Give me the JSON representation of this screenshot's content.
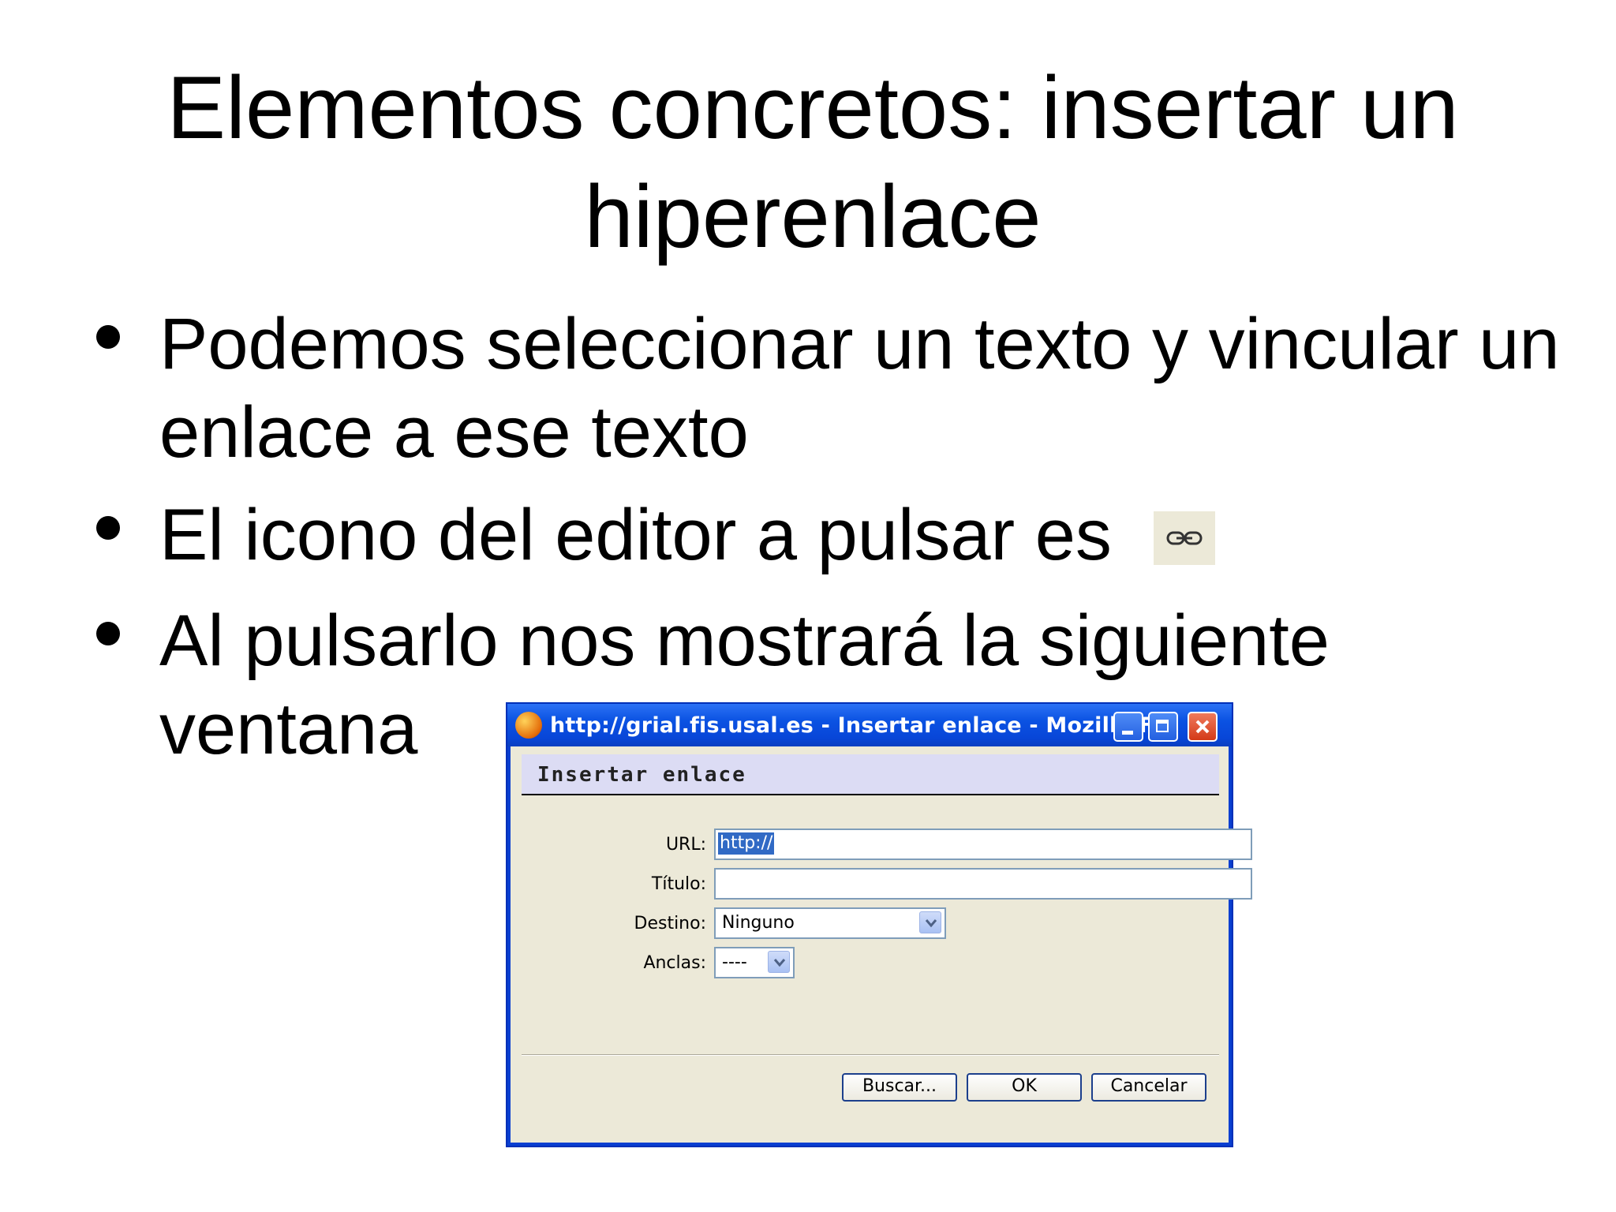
{
  "slide": {
    "title": "Elementos concretos: insertar un hiperenlace",
    "bullets": [
      {
        "text": "Podemos seleccionar un texto y vincular un enlace a ese texto"
      },
      {
        "text": "El icono del editor a pulsar es"
      },
      {
        "text": "Al pulsarlo nos mostrará la siguiente ventana"
      }
    ],
    "editor_icon": "link-icon"
  },
  "dialog": {
    "window_title": "http://grial.fis.usal.es - Insertar enlace - Mozilla F...",
    "header": "Insertar enlace",
    "fields": {
      "url": {
        "label": "URL:",
        "value": "http://"
      },
      "titulo": {
        "label": "Título:",
        "value": ""
      },
      "destino": {
        "label": "Destino:",
        "value": "Ninguno"
      },
      "anclas": {
        "label": "Anclas:",
        "value": "----"
      }
    },
    "buttons": {
      "buscar": "Buscar...",
      "ok": "OK",
      "cancelar": "Cancelar"
    },
    "colors": {
      "titlebar": "#0b52e2",
      "client_bg": "#ece9d8",
      "header_band": "#dcdcf4",
      "selection": "#316ac5"
    }
  }
}
